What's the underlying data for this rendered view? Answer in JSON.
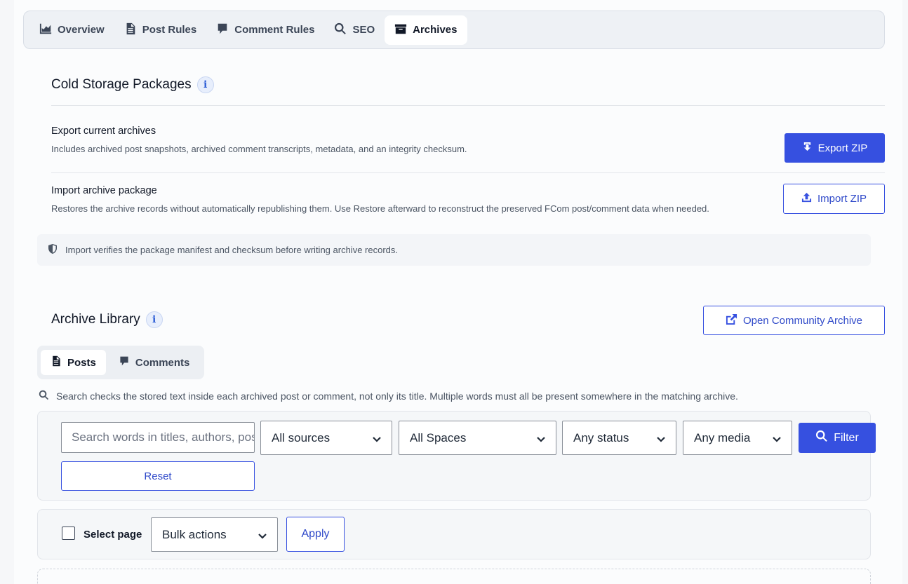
{
  "tabs": [
    {
      "label": "Overview",
      "icon": "chart-area-icon"
    },
    {
      "label": "Post Rules",
      "icon": "document-icon"
    },
    {
      "label": "Comment Rules",
      "icon": "comment-icon"
    },
    {
      "label": "SEO",
      "icon": "search-icon"
    },
    {
      "label": "Archives",
      "icon": "archive-box-icon",
      "active": true
    }
  ],
  "cold_storage": {
    "title": "Cold Storage Packages",
    "info": "i",
    "export": {
      "title": "Export current archives",
      "description": "Includes archived post snapshots, archived comment transcripts, metadata, and an integrity checksum.",
      "button": "Export ZIP"
    },
    "import": {
      "title": "Import archive package",
      "description": "Restores the archive records without automatically republishing them. Use Restore afterward to reconstruct the preserved FCom post/comment data when needed.",
      "button": "Import ZIP"
    },
    "notice": "Import verifies the package manifest and checksum before writing archive records."
  },
  "library": {
    "title": "Archive Library",
    "info": "i",
    "open_button": "Open Community Archive",
    "subtabs": [
      {
        "label": "Posts",
        "active": true
      },
      {
        "label": "Comments"
      }
    ],
    "search_hint": "Search checks the stored text inside each archived post or comment, not only its title. Multiple words must all be present somewhere in the matching archive.",
    "filters": {
      "search_placeholder": "Search words in titles, authors, posts, or comments",
      "source": "All sources",
      "space": "All Spaces",
      "status": "Any status",
      "media": "Any media",
      "filter_button": "Filter",
      "reset_button": "Reset"
    },
    "bulk": {
      "select_page": "Select page",
      "bulk_actions": "Bulk actions",
      "apply": "Apply"
    }
  },
  "colors": {
    "accent": "#3650e0",
    "background": "#fbfcfd"
  }
}
